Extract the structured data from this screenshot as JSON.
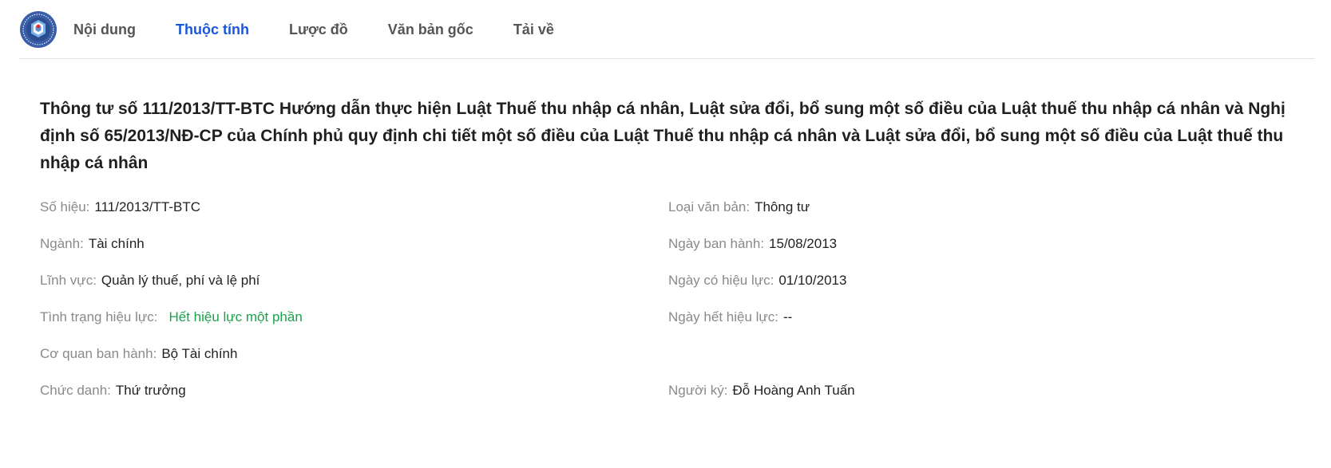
{
  "nav": {
    "tabs": [
      {
        "label": "Nội dung"
      },
      {
        "label": "Thuộc tính"
      },
      {
        "label": "Lược đồ"
      },
      {
        "label": "Văn bản gốc"
      },
      {
        "label": "Tải về"
      }
    ],
    "active_tab": "Thuộc tính"
  },
  "document": {
    "title": "Thông tư số 111/2013/TT-BTC Hướng dẫn thực hiện Luật Thuế thu nhập cá nhân, Luật sửa đổi, bổ sung một số điều của Luật thuế thu nhập cá nhân và Nghị định số 65/2013/NĐ-CP của Chính phủ quy định chi tiết một số điều của Luật Thuế thu nhập cá nhân và Luật sửa đổi, bổ sung một số điều của Luật thuế thu nhập cá nhân"
  },
  "properties": {
    "so_hieu": {
      "label": "Số hiệu:",
      "value": "111/2013/TT-BTC"
    },
    "loai_van_ban": {
      "label": "Loại văn bản:",
      "value": "Thông tư"
    },
    "nganh": {
      "label": "Ngành:",
      "value": "Tài chính"
    },
    "ngay_ban_hanh": {
      "label": "Ngày ban hành:",
      "value": "15/08/2013"
    },
    "linh_vuc": {
      "label": "Lĩnh vực:",
      "value": "Quản lý thuế, phí và lệ phí"
    },
    "ngay_co_hieu_luc": {
      "label": "Ngày có hiệu lực:",
      "value": "01/10/2013"
    },
    "tinh_trang_hieu_luc": {
      "label": "Tình trạng hiệu lực:",
      "value": "Hết hiệu lực một phần"
    },
    "ngay_het_hieu_luc": {
      "label": "Ngày hết hiệu lực:",
      "value": "--"
    },
    "co_quan_ban_hanh": {
      "label": "Cơ quan ban hành:",
      "value": "Bộ Tài chính"
    },
    "chuc_danh": {
      "label": "Chức danh:",
      "value": "Thứ trưởng"
    },
    "nguoi_ky": {
      "label": "Người ký:",
      "value": "Đỗ Hoàng Anh Tuấn"
    }
  },
  "colors": {
    "active_tab": "#1a56db",
    "status_green": "#1aa34a",
    "label_gray": "#8a8a8a"
  },
  "icons": {
    "logo": "government-seal-logo-icon"
  }
}
